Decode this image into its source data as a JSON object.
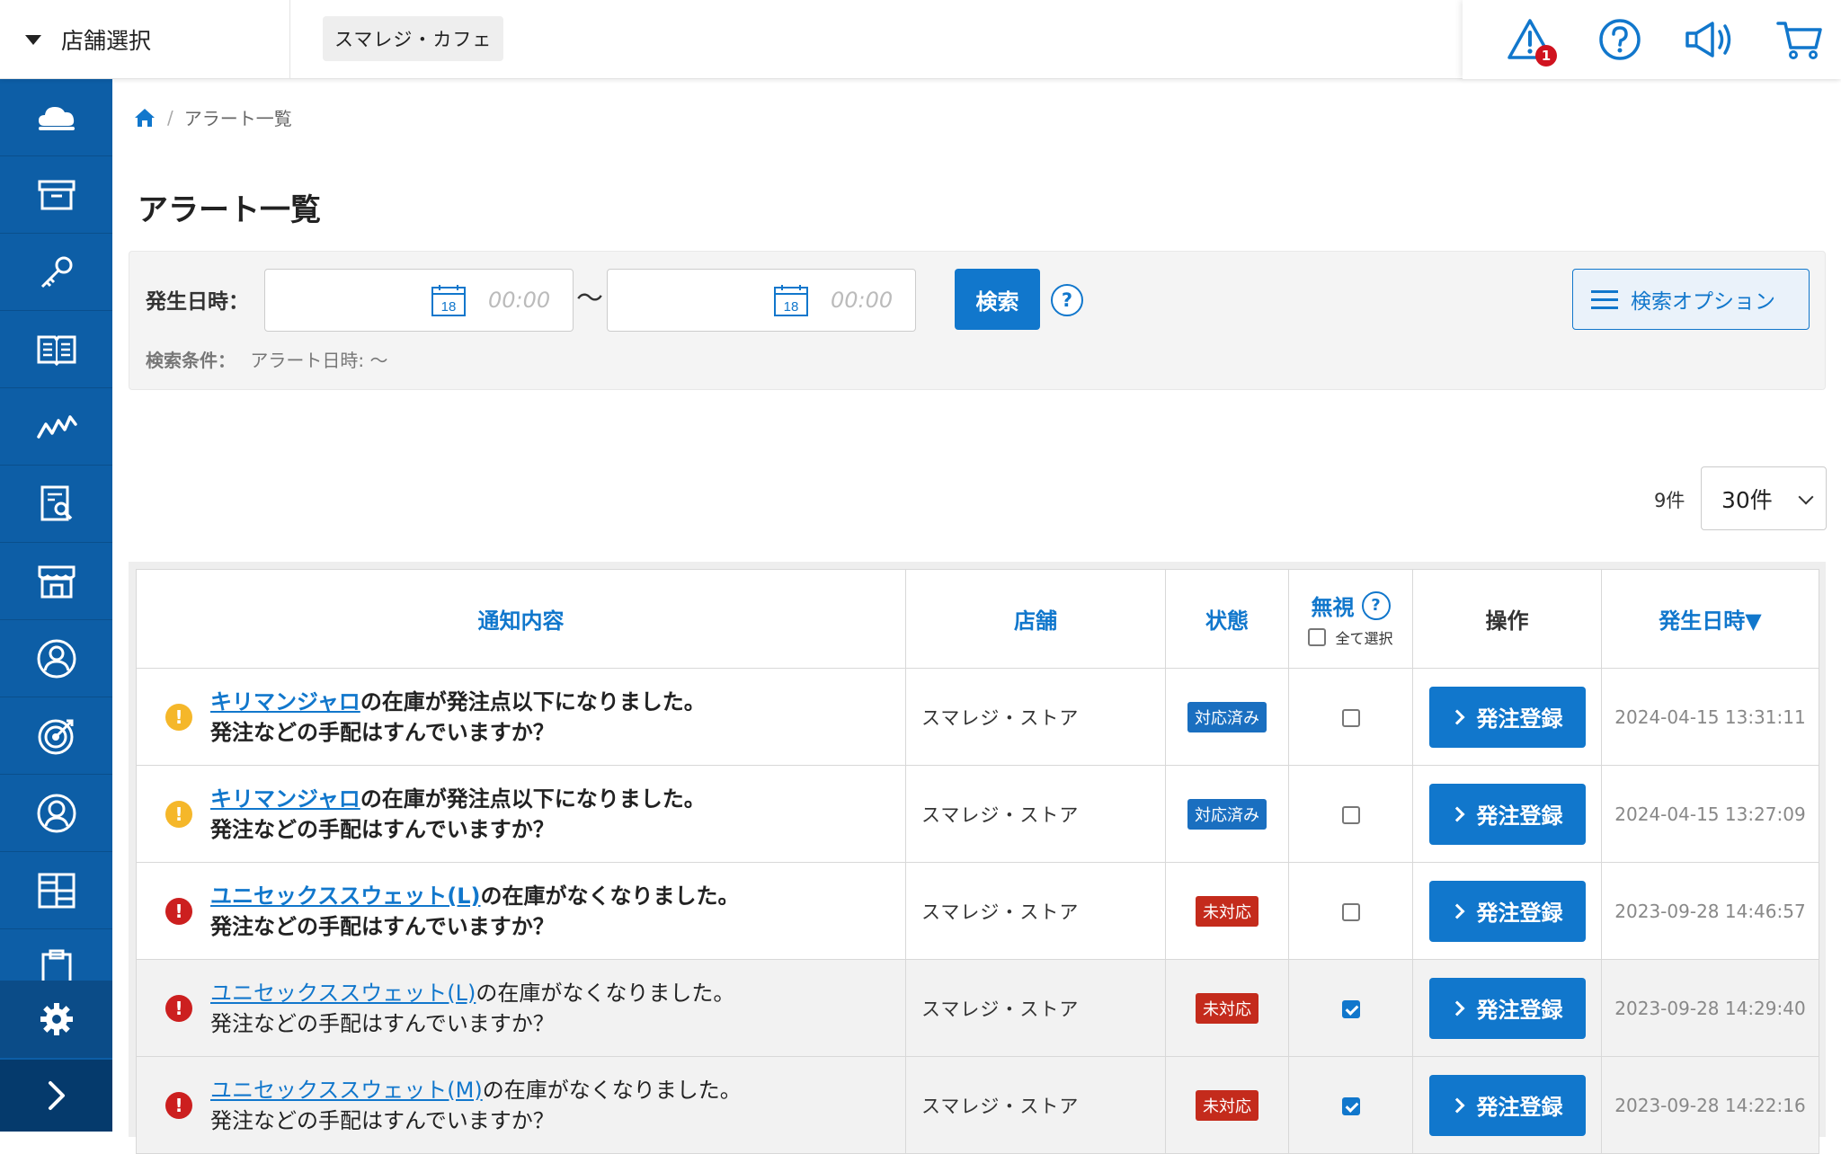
{
  "topbar": {
    "store_select_label": "店舗選択",
    "current_store": "スマレジ・カフェ",
    "alert_badge": "1"
  },
  "breadcrumb": {
    "current": "アラート一覧"
  },
  "page_title": "アラート一覧",
  "search": {
    "date_label": "発生日時：",
    "from_day": "18",
    "from_time_placeholder": "00:00",
    "tilde": "〜",
    "to_day": "18",
    "to_time_placeholder": "00:00",
    "search_button": "検索",
    "help": "?",
    "option_button": "検索オプション",
    "condition_label": "検索条件：",
    "condition_value": "アラート日時: 〜"
  },
  "paging": {
    "count": "9件",
    "per_page": "30件"
  },
  "table": {
    "headers": {
      "content": "通知内容",
      "store": "店舗",
      "status": "状態",
      "ignore": "無視",
      "ignore_help": "?",
      "select_all": "全て選択",
      "action": "操作",
      "date": "発生日時▼"
    },
    "rows": [
      {
        "level": "warning",
        "item": "キリマンジャロ",
        "message1": "の在庫が発注点以下になりました。",
        "message2": "発注などの手配はすんでいますか？",
        "store": "スマレジ・ストア",
        "status": "対応済み",
        "ignored": false,
        "action": "発注登録",
        "date": "2024-04-15 13:31:11"
      },
      {
        "level": "warning",
        "item": "キリマンジャロ",
        "message1": "の在庫が発注点以下になりました。",
        "message2": "発注などの手配はすんでいますか？",
        "store": "スマレジ・ストア",
        "status": "対応済み",
        "ignored": false,
        "action": "発注登録",
        "date": "2024-04-15 13:27:09"
      },
      {
        "level": "danger",
        "item": "ユニセックススウェット(L)",
        "message1": "の在庫がなくなりました。",
        "message2": "発注などの手配はすんでいますか？",
        "store": "スマレジ・ストア",
        "status": "未対応",
        "ignored": false,
        "action": "発注登録",
        "date": "2023-09-28 14:46:57"
      },
      {
        "level": "danger",
        "item": "ユニセックススウェット(L)",
        "message1": "の在庫がなくなりました。",
        "message2": "発注などの手配はすんでいますか？",
        "store": "スマレジ・ストア",
        "status": "未対応",
        "ignored": true,
        "action": "発注登録",
        "date": "2023-09-28 14:29:40"
      },
      {
        "level": "danger",
        "item": "ユニセックススウェット(M)",
        "message1": "の在庫がなくなりました。",
        "message2": "発注などの手配はすんでいますか？",
        "store": "スマレジ・ストア",
        "status": "未対応",
        "ignored": true,
        "action": "発注登録",
        "date": "2023-09-28 14:22:16"
      }
    ]
  },
  "colors": {
    "primary": "#1177cc",
    "sidebar": "#0d5ea6",
    "warning": "#f5b72a",
    "danger": "#cc1f1f",
    "status_done": "#1a6fc0",
    "status_open": "#c42b1c"
  },
  "icons": {
    "sidebar": [
      "cloud-icon",
      "archive-icon",
      "key-icon",
      "book-icon",
      "chart-line-icon",
      "report-icon",
      "store-icon",
      "user-circle-icon",
      "target-icon",
      "person-icon",
      "grid-icon",
      "clipboard-icon"
    ],
    "top": [
      "alert-triangle-icon",
      "help-circle-icon",
      "megaphone-icon",
      "cart-icon"
    ]
  }
}
